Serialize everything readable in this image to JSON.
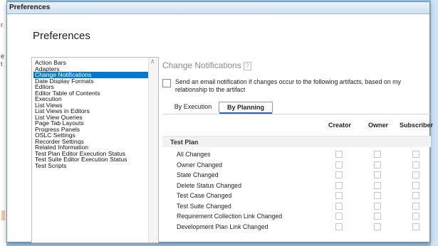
{
  "window": {
    "title": "Preferences"
  },
  "page": {
    "title": "Preferences"
  },
  "background": {
    "left_chars": [
      "r",
      "e",
      "t"
    ]
  },
  "nav": {
    "items": [
      "Action Bars",
      "Adapters",
      "Change Notifications",
      "Date Display Formats",
      "Editors",
      "Editor Table of Contents",
      "Execution",
      "List Views",
      "List Views in Editors",
      "List View Queries",
      "Page Tab Layouts",
      "Progress Panels",
      "OSLC Settings",
      "Recorder Settings",
      "Related Information",
      "Test Plan Editor Execution Status",
      "Test Suite Editor Execution Status",
      "Test Scripts"
    ],
    "selected": "Change Notifications"
  },
  "section": {
    "title": "Change Notifications",
    "help_icon": "?",
    "email_label": "Send an email notification if changes occur to the following artifacts, based on my relationship to the artifact",
    "email_checked": false
  },
  "tabs": {
    "execution": "By Execution",
    "planning": "By Planning",
    "active": "By Planning"
  },
  "columns": {
    "creator": "Creator",
    "owner": "Owner",
    "subscriber": "Subscriber"
  },
  "group": {
    "title": "Test Plan",
    "rows": [
      "All Changes",
      "Owner Changed",
      "State Changed",
      "Delete Status Changed",
      "Test Case Changed",
      "Test Suite Changed",
      "Requirement Collection Link Changed",
      "Development Plan Link Changed"
    ]
  },
  "colors": {
    "selection": "#0078d7",
    "tab_accent": "#2b65c4",
    "desktop": "#9fc3e0"
  }
}
